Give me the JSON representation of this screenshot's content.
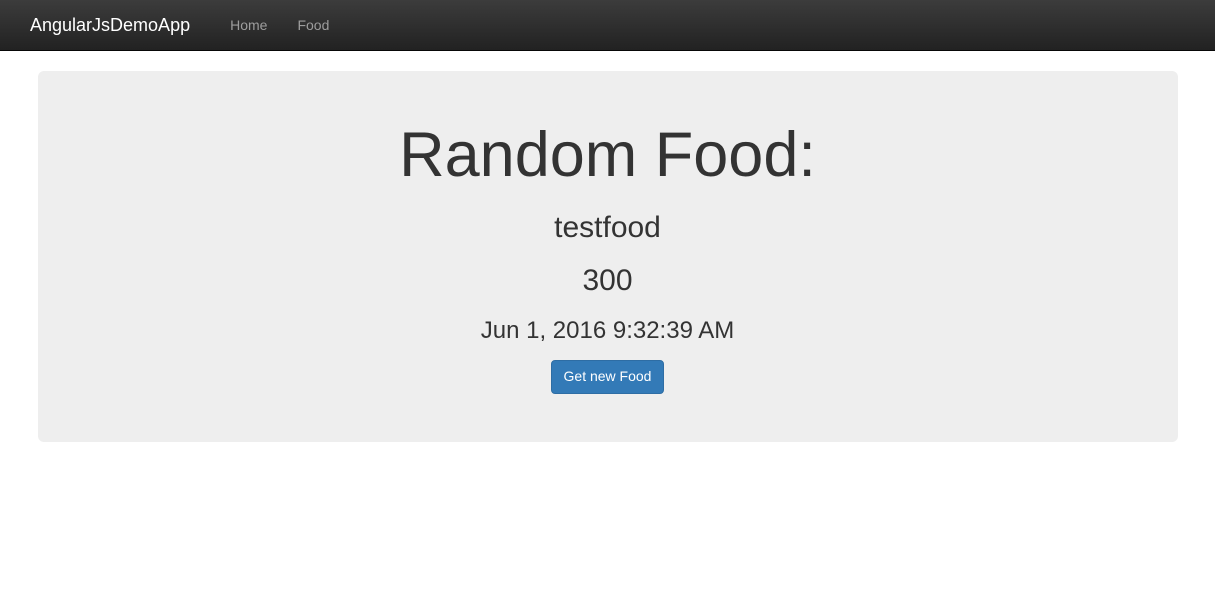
{
  "navbar": {
    "brand": "AngularJsDemoApp",
    "items": [
      {
        "label": "Home"
      },
      {
        "label": "Food"
      }
    ]
  },
  "main": {
    "heading": "Random Food:",
    "food_name": "testfood",
    "food_value": "300",
    "timestamp": "Jun 1, 2016 9:32:39 AM",
    "button_label": "Get new Food"
  }
}
